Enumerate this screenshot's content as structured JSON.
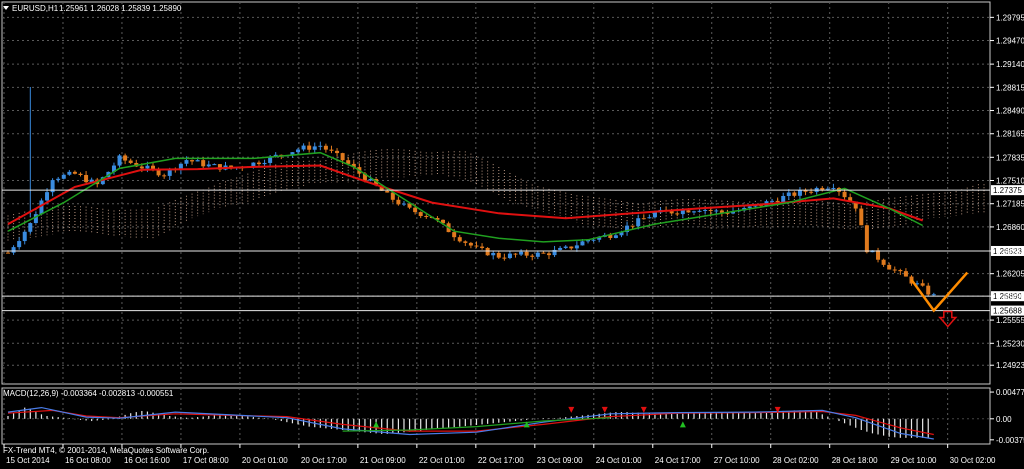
{
  "header": {
    "symbol": "EURUSD,H1",
    "ohlc": "1.25961 1.26028 1.25839 1.25890"
  },
  "macd_label": "MACD(12,26,9) -0.003364 -0.002813 -0.000551",
  "copyright": "FX-Trend MT4, © 2001-2014, MetaQuotes Software Corp.",
  "colors": {
    "background": "#000000",
    "grid": "#5a5a5a",
    "bull": "#3a8ce0",
    "bear": "#e07a1e",
    "ma_red": "#e01010",
    "ma_green": "#20a020",
    "cloud": "#d8b098",
    "arrow": "#e01010",
    "zigzag": "#ff8c00"
  },
  "chart_data": [
    {
      "type": "candlestick",
      "title": "EURUSD,H1",
      "ylim": [
        1.2466,
        1.3001
      ],
      "price_ticks": [
        "1.29795",
        "1.29470",
        "1.29140",
        "1.28815",
        "1.28490",
        "1.28165",
        "1.27835",
        "1.27510",
        "1.27185",
        "1.26860",
        "1.26523",
        "1.26205",
        "1.25890",
        "1.25555",
        "1.25230",
        "1.24923"
      ],
      "highlighted_levels": [
        {
          "value": 1.27375,
          "label": "1.27375"
        },
        {
          "value": 1.26523,
          "label": "1.26523"
        },
        {
          "value": 1.2589,
          "label": "1.25890"
        },
        {
          "value": 1.25688,
          "label": "1.25688"
        }
      ],
      "x_labels": [
        "15 Oct 2014",
        "16 Oct 08:00",
        "16 Oct 16:00",
        "17 Oct 08:00",
        "20 Oct 01:00",
        "20 Oct 17:00",
        "21 Oct 09:00",
        "22 Oct 01:00",
        "22 Oct 17:00",
        "23 Oct 09:00",
        "24 Oct 01:00",
        "24 Oct 17:00",
        "27 Oct 10:00",
        "28 Oct 02:00",
        "28 Oct 18:00",
        "29 Oct 10:00",
        "30 Oct 02:00"
      ],
      "price_path": [
        [
          0,
          1.265
        ],
        [
          4,
          1.269
        ],
        [
          8,
          1.2755
        ],
        [
          12,
          1.276
        ],
        [
          16,
          1.2745
        ],
        [
          20,
          1.2782
        ],
        [
          24,
          1.277
        ],
        [
          28,
          1.276
        ],
        [
          32,
          1.278
        ],
        [
          36,
          1.2772
        ],
        [
          40,
          1.2768
        ],
        [
          44,
          1.2775
        ],
        [
          48,
          1.2785
        ],
        [
          52,
          1.2795
        ],
        [
          56,
          1.28
        ],
        [
          60,
          1.278
        ],
        [
          64,
          1.2755
        ],
        [
          68,
          1.273
        ],
        [
          72,
          1.271
        ],
        [
          76,
          1.27
        ],
        [
          80,
          1.2675
        ],
        [
          84,
          1.2655
        ],
        [
          88,
          1.2645
        ],
        [
          92,
          1.2647
        ],
        [
          96,
          1.2648
        ],
        [
          100,
          1.2655
        ],
        [
          104,
          1.2668
        ],
        [
          108,
          1.2675
        ],
        [
          112,
          1.269
        ],
        [
          116,
          1.2705
        ],
        [
          120,
          1.2708
        ],
        [
          124,
          1.2712
        ],
        [
          128,
          1.2706
        ],
        [
          132,
          1.271
        ],
        [
          136,
          1.272
        ],
        [
          140,
          1.273
        ],
        [
          144,
          1.2738
        ],
        [
          148,
          1.2745
        ],
        [
          152,
          1.2715
        ],
        [
          154,
          1.2655
        ],
        [
          158,
          1.263
        ],
        [
          162,
          1.261
        ],
        [
          166,
          1.2589
        ]
      ],
      "series": [
        {
          "name": "MA red",
          "points": [
            [
              0,
              1.269
            ],
            [
              12,
              1.2742
            ],
            [
              24,
              1.2766
            ],
            [
              34,
              1.2767
            ],
            [
              44,
              1.277
            ],
            [
              56,
              1.2772
            ],
            [
              64,
              1.275
            ],
            [
              76,
              1.272
            ],
            [
              88,
              1.2705
            ],
            [
              100,
              1.2698
            ],
            [
              112,
              1.2705
            ],
            [
              124,
              1.2712
            ],
            [
              136,
              1.2718
            ],
            [
              148,
              1.2726
            ],
            [
              158,
              1.2712
            ],
            [
              164,
              1.2695
            ]
          ]
        },
        {
          "name": "MA green",
          "points": [
            [
              0,
              1.268
            ],
            [
              10,
              1.272
            ],
            [
              20,
              1.2768
            ],
            [
              30,
              1.2782
            ],
            [
              44,
              1.2782
            ],
            [
              56,
              1.279
            ],
            [
              62,
              1.277
            ],
            [
              70,
              1.273
            ],
            [
              80,
              1.268
            ],
            [
              88,
              1.267
            ],
            [
              96,
              1.2665
            ],
            [
              104,
              1.2668
            ],
            [
              116,
              1.269
            ],
            [
              128,
              1.2705
            ],
            [
              140,
              1.272
            ],
            [
              150,
              1.274
            ],
            [
              158,
              1.2712
            ],
            [
              164,
              1.2688
            ]
          ]
        }
      ],
      "annotations": [
        {
          "type": "down-arrow",
          "x": 166,
          "value": 1.2555
        },
        {
          "type": "zigzag",
          "points": [
            [
              162,
              1.2612
            ],
            [
              166,
              1.2569
            ],
            [
              172,
              1.2622
            ]
          ]
        }
      ]
    },
    {
      "type": "bar",
      "title": "MACD(12,26,9) -0.003364 -0.002813 -0.000551",
      "ylim": [
        -0.0045,
        0.0055
      ],
      "ticks": [
        "0.004775",
        "0.00",
        "-0.003755"
      ],
      "histogram": [
        {
          "from": 0,
          "to": 20,
          "values": [
            0.0005,
            0.001,
            0.0015,
            0.002,
            0.0018,
            0.0012,
            0.0008,
            0.0005,
            0.0004,
            0.0003,
            0.0002,
            0.0001,
            -0.0001,
            -0.0002,
            -0.0003,
            -0.0004,
            -0.0003,
            -0.0002,
            -0.0001,
            0.0001
          ]
        },
        {
          "from": 20,
          "to": 60,
          "values": [
            0.0004,
            0.0007,
            0.001,
            0.0012,
            0.0014,
            0.0013,
            0.0011,
            0.0009,
            0.0007,
            0.0005,
            0.0004,
            0.0003,
            0.0002,
            0.0002,
            0.0003,
            0.0004,
            0.0005,
            0.0006,
            0.0007,
            0.0008,
            0.0007,
            0.0006,
            0.0005,
            0.0004,
            0.0003,
            0.0002,
            0.0001,
            0.0,
            -0.0002,
            -0.0004,
            -0.0006,
            -0.0008,
            -0.001,
            -0.0012,
            -0.0014,
            -0.0015,
            -0.0016,
            -0.0017,
            -0.0018,
            -0.0019
          ]
        },
        {
          "from": 60,
          "to": 100,
          "values": [
            -0.002,
            -0.0021,
            -0.0022,
            -0.0023,
            -0.0024,
            -0.0025,
            -0.0026,
            -0.0027,
            -0.0027,
            -0.0026,
            -0.0025,
            -0.0024,
            -0.0023,
            -0.0022,
            -0.0021,
            -0.002,
            -0.0019,
            -0.0018,
            -0.0017,
            -0.0016,
            -0.0015,
            -0.0014,
            -0.0013,
            -0.0012,
            -0.0011,
            -0.001,
            -0.0009,
            -0.0008,
            -0.0007,
            -0.0006,
            -0.0005,
            -0.0004,
            -0.0003,
            -0.0002,
            -0.0001,
            0.0,
            0.0001,
            0.0001,
            0.0001,
            0.0002
          ]
        },
        {
          "from": 100,
          "to": 150,
          "values": [
            0.0003,
            0.0004,
            0.0005,
            0.0006,
            0.0007,
            0.0008,
            0.0009,
            0.001,
            0.0011,
            0.0012,
            0.0012,
            0.0012,
            0.0011,
            0.0011,
            0.001,
            0.001,
            0.0009,
            0.0009,
            0.0009,
            0.0009,
            0.0009,
            0.0009,
            0.001,
            0.001,
            0.001,
            0.0011,
            0.0011,
            0.0011,
            0.0011,
            0.0011,
            0.0011,
            0.0011,
            0.0011,
            0.0012,
            0.0012,
            0.0012,
            0.0013,
            0.0013,
            0.0014,
            0.0014,
            0.0014,
            0.0015,
            0.0015,
            0.0015,
            0.0014,
            0.0012,
            0.0008,
            0.0004,
            0.0,
            -0.0004
          ]
        },
        {
          "from": 150,
          "to": 166,
          "values": [
            -0.0008,
            -0.0012,
            -0.0016,
            -0.002,
            -0.0023,
            -0.0026,
            -0.0028,
            -0.003,
            -0.0032,
            -0.0033,
            -0.0034,
            -0.0034,
            -0.0034,
            -0.0034,
            -0.0034,
            -0.0034
          ]
        }
      ],
      "series": [
        {
          "name": "signal red",
          "points": [
            [
              0,
              0.001
            ],
            [
              8,
              0.0015
            ],
            [
              14,
              0.0005
            ],
            [
              20,
              0.0002
            ],
            [
              30,
              0.0009
            ],
            [
              40,
              0.0006
            ],
            [
              50,
              0.0004
            ],
            [
              60,
              -0.001
            ],
            [
              72,
              -0.0022
            ],
            [
              84,
              -0.0022
            ],
            [
              96,
              -0.001
            ],
            [
              108,
              0.0004
            ],
            [
              120,
              0.001
            ],
            [
              134,
              0.0011
            ],
            [
              146,
              0.0013
            ],
            [
              152,
              0.0006
            ],
            [
              160,
              -0.0016
            ],
            [
              166,
              -0.0028
            ]
          ]
        },
        {
          "name": "macd blue",
          "points": [
            [
              0,
              0.0012
            ],
            [
              6,
              0.002
            ],
            [
              14,
              0.0003
            ],
            [
              20,
              0.0001
            ],
            [
              30,
              0.0012
            ],
            [
              40,
              0.0007
            ],
            [
              50,
              0.0002
            ],
            [
              60,
              -0.0018
            ],
            [
              72,
              -0.0028
            ],
            [
              84,
              -0.0024
            ],
            [
              96,
              -0.0006
            ],
            [
              108,
              0.0009
            ],
            [
              120,
              0.0011
            ],
            [
              134,
              0.0012
            ],
            [
              146,
              0.0015
            ],
            [
              152,
              0.0002
            ],
            [
              160,
              -0.0026
            ],
            [
              166,
              -0.0036
            ]
          ]
        },
        {
          "name": "green",
          "points": [
            [
              60,
              -0.0022
            ],
            [
              72,
              -0.002
            ],
            [
              84,
              -0.0014
            ],
            [
              96,
              -0.0004
            ],
            [
              108,
              0.0002
            ]
          ]
        }
      ],
      "arrow_marks": [
        {
          "kind": "up",
          "color": "green",
          "x": 66
        },
        {
          "kind": "up",
          "color": "green",
          "x": 93
        },
        {
          "kind": "up",
          "color": "green",
          "x": 121
        },
        {
          "kind": "down",
          "color": "red",
          "x": 101
        },
        {
          "kind": "down",
          "color": "red",
          "x": 107
        },
        {
          "kind": "down",
          "color": "red",
          "x": 114
        },
        {
          "kind": "down",
          "color": "red",
          "x": 138
        }
      ]
    }
  ]
}
